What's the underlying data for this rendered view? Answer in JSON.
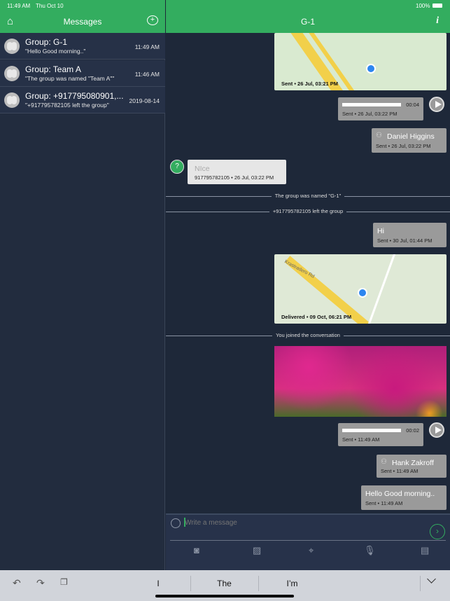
{
  "status": {
    "time": "11:49 AM",
    "date": "Thu Oct 10",
    "battery": "100%"
  },
  "left": {
    "title": "Messages",
    "conversations": [
      {
        "name": "Group: G-1",
        "preview": "\"Hello Good morning..\"",
        "time": "11:49 AM"
      },
      {
        "name": "Group: Team A",
        "preview": "\"The group was named \"Team A\"\"",
        "time": "11:46 AM"
      },
      {
        "name": "Group: +917795080901,...",
        "preview": "\"+917795782105 left the group\"",
        "time": "2019-08-14"
      }
    ]
  },
  "chat": {
    "title": "G-1",
    "messages": {
      "map1_meta": "Sent • 26 Jul, 03:21 PM",
      "audio1_dur": "00:04",
      "audio1_meta": "Sent • 26 Jul, 03:22 PM",
      "contact1_name": "Daniel Higgins",
      "contact1_meta": "Sent • 26 Jul, 03:22 PM",
      "recv_avatar": "?",
      "recv_text": "NIce",
      "recv_meta": "917795782105 • 26 Jul, 03:22 PM",
      "sys1": "The group was named \"G-1\"",
      "sys2": "+917795782105 left the group",
      "hi_text": "Hi",
      "hi_meta": "Sent • 30 Jul, 01:44 PM",
      "map2_meta": "Delivered • 09 Oct, 06:21 PM",
      "map2_road": "Krastradero Rd",
      "sys3": "You joined the conversation",
      "audio2_dur": "00:02",
      "audio2_meta": "Sent • 11:49 AM",
      "contact2_name": "Hank Zakroff",
      "contact2_meta": "Sent • 11:49 AM",
      "last_text": "Hello Good morning..",
      "last_meta": "Sent • 11:49 AM"
    }
  },
  "compose": {
    "placeholder": "Write a message"
  },
  "keyboard": {
    "suggestions": [
      "I",
      "The",
      "I’m"
    ]
  },
  "colors": {
    "accent": "#33ad5f",
    "background": "#1e2839"
  }
}
